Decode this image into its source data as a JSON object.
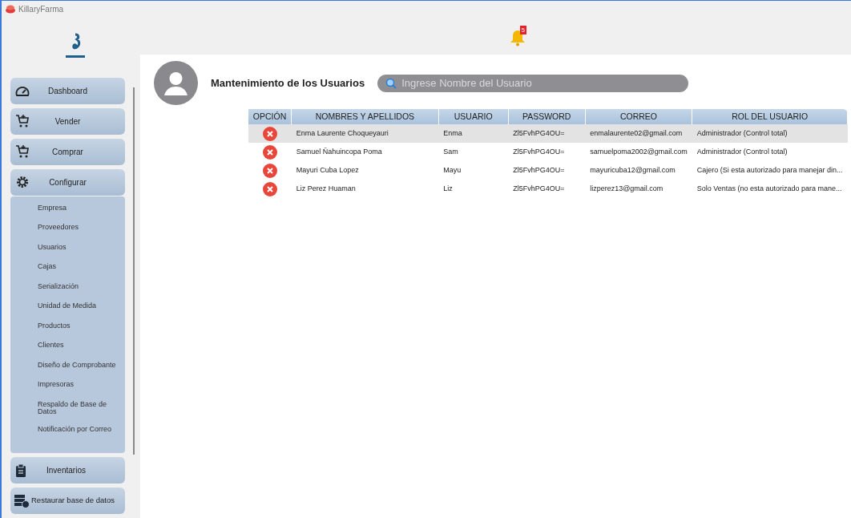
{
  "window": {
    "title": "KillaryFarma"
  },
  "notifications": {
    "count": "5"
  },
  "sidebar": {
    "items": [
      {
        "label": "Dashboard",
        "kind": "gauge"
      },
      {
        "label": "Vender",
        "kind": "cart"
      },
      {
        "label": "Comprar",
        "kind": "cart"
      },
      {
        "label": "Configurar",
        "kind": "gear",
        "children": [
          {
            "label": "Empresa"
          },
          {
            "label": "Proveedores"
          },
          {
            "label": "Usuarios"
          },
          {
            "label": "Cajas"
          },
          {
            "label": "Serialización"
          },
          {
            "label": "Unidad de Medida"
          },
          {
            "label": "Productos"
          },
          {
            "label": "Clientes"
          },
          {
            "label": "Diseño de Comprobante"
          },
          {
            "label": "Impresoras"
          },
          {
            "label": "Respaldo de Base de Datos"
          },
          {
            "label": "Notificación por Correo"
          }
        ]
      },
      {
        "label": "Inventarios",
        "kind": "clipboard"
      },
      {
        "label": "Restaurar base de datos",
        "kind": "database"
      }
    ]
  },
  "page": {
    "title": "Mantenimiento de los Usuarios",
    "search": {
      "placeholder": "Ingrese Nombre del Usuario"
    }
  },
  "table": {
    "columns": [
      "OPCIÓN",
      "NOMBRES Y APELLIDOS",
      "USUARIO",
      "PASSWORD",
      "CORREO",
      "ROL DEL USUARIO"
    ],
    "rows": [
      {
        "selected": true,
        "cells": [
          "",
          "Enma Laurente Choqueyauri",
          "Enma",
          "Zl5FvhPG4OU=",
          "enmalaurente02@gmail.com",
          "Administrador (Control total)"
        ]
      },
      {
        "selected": false,
        "cells": [
          "",
          "Samuel Ñahuincopa Poma",
          "Sam",
          "Zl5FvhPG4OU=",
          "samuelpoma2002@gmail.com",
          "Administrador (Control total)"
        ]
      },
      {
        "selected": false,
        "cells": [
          "",
          "Mayuri Cuba Lopez",
          "Mayu",
          "Zl5FvhPG4OU=",
          "mayuricuba12@gmail.com",
          "Cajero (Si esta autorizado para manejar din..."
        ]
      },
      {
        "selected": false,
        "cells": [
          "",
          "Liz Perez Huaman",
          "Liz",
          "Zl5FvhPG4OU=",
          "lizperez13@gmail.com",
          "Solo Ventas (no esta autorizado para mane..."
        ]
      }
    ]
  }
}
